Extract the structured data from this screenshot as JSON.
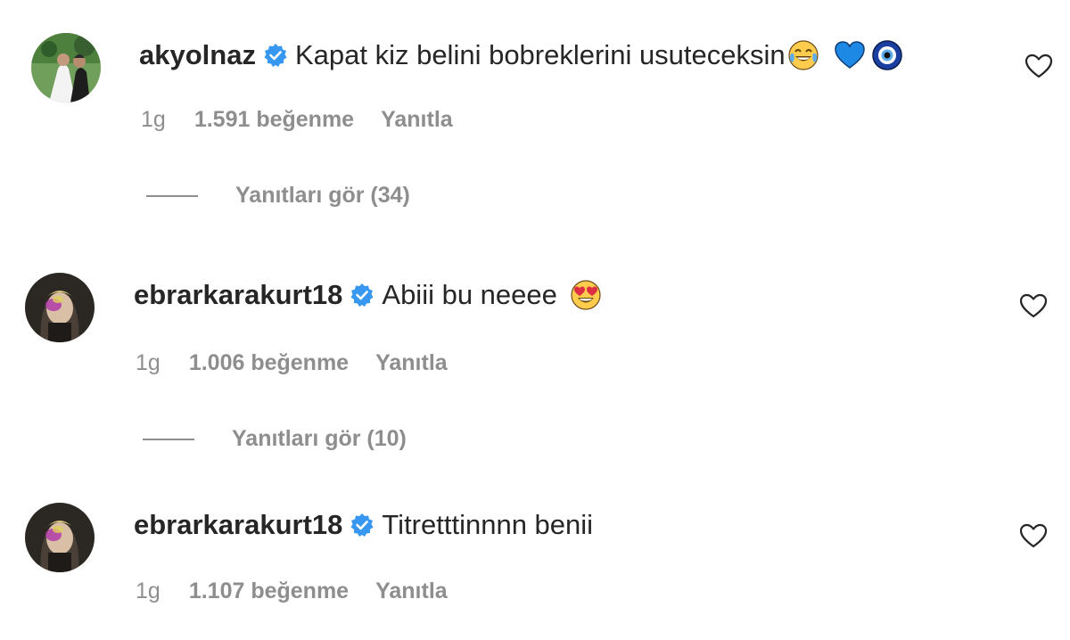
{
  "comments": [
    {
      "username": "akyolnaz",
      "text": "Kapat kiz belini bobreklerini usuteceksin",
      "emojis": [
        "joy-emoji",
        "blue-heart-emoji",
        "nazar-emoji"
      ],
      "time": "1g",
      "likes": "1.591 beğenme",
      "reply_label": "Yanıtla",
      "view_replies": "Yanıtları gör (34)"
    },
    {
      "username": "ebrarkarakurt18",
      "text": "Abiii bu neeee",
      "emojis": [
        "heart-eyes-emoji"
      ],
      "time": "1g",
      "likes": "1.006 beğenme",
      "reply_label": "Yanıtla",
      "view_replies": "Yanıtları gör (10)"
    },
    {
      "username": "ebrarkarakurt18",
      "text": "Titretttinnnn benii",
      "emojis": [],
      "time": "1g",
      "likes": "1.107 beğenme",
      "reply_label": "Yanıtla"
    }
  ],
  "icons": {
    "verified": "verified-badge-icon",
    "like": "heart-outline-icon"
  },
  "colors": {
    "verified_blue": "#3897f0",
    "text_primary": "#262626",
    "text_secondary": "#8e8e8e"
  }
}
